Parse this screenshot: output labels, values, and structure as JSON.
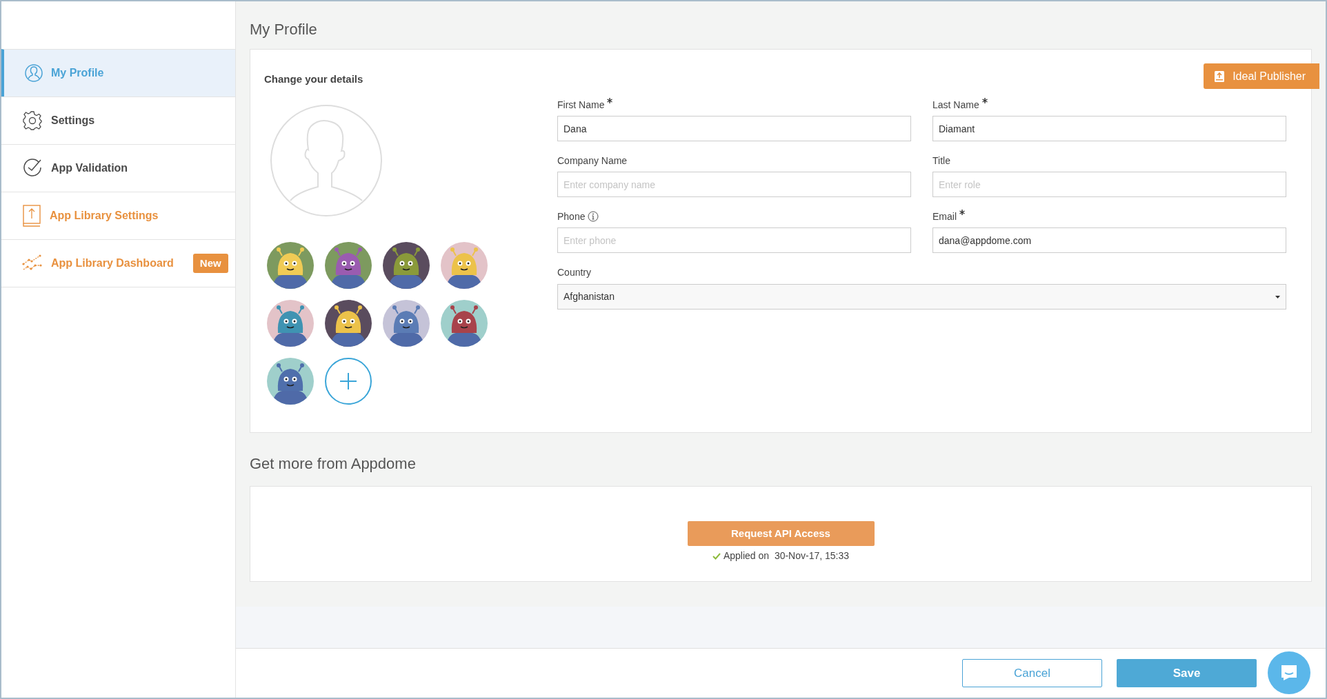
{
  "sidebar": {
    "items": [
      {
        "kind": "profile",
        "label": "My Profile",
        "selected": true,
        "color": "#4aa3d6"
      },
      {
        "kind": "settings",
        "label": "Settings",
        "selected": false,
        "color": "#4a4a4a"
      },
      {
        "kind": "validation",
        "label": "App Validation",
        "selected": false,
        "color": "#4a4a4a"
      },
      {
        "kind": "library",
        "label": "App Library Settings",
        "selected": false,
        "color": "#e8913f"
      },
      {
        "kind": "dashboard",
        "label": "App Library Dashboard",
        "selected": false,
        "color": "#e8913f",
        "badge": "New"
      }
    ]
  },
  "page_title": "My Profile",
  "details": {
    "heading": "Change your details",
    "ribbon": "Ideal Publisher",
    "avatars": [
      {
        "color": "#7d9a5f"
      },
      {
        "color": "#7d9a5f"
      },
      {
        "color": "#5a4c5e"
      },
      {
        "color": "#e3c3c8"
      },
      {
        "color": "#e3c3c8"
      },
      {
        "color": "#5a4c5e"
      },
      {
        "color": "#c5c3d8"
      },
      {
        "color": "#9fcfcb"
      },
      {
        "color": "#9fcfcb"
      }
    ],
    "fields": [
      {
        "label": "First Name",
        "required": true,
        "info": false,
        "value": "Dana"
      },
      {
        "label": "Last Name",
        "required": true,
        "info": false,
        "value": "Diamant"
      },
      {
        "label": "Company Name",
        "required": false,
        "info": false,
        "placeholder": "Enter company name"
      },
      {
        "label": "Title",
        "required": false,
        "info": false,
        "placeholder": "Enter role"
      },
      {
        "label": "Phone",
        "required": false,
        "info": true,
        "placeholder": "Enter phone"
      },
      {
        "label": "Email",
        "required": true,
        "info": false,
        "value": "dana@appdome.com"
      }
    ],
    "country": {
      "label": "Country",
      "value": "Afghanistan"
    }
  },
  "more": {
    "heading": "Get more from Appdome",
    "button": "Request API Access",
    "applied": "Applied on  30-Nov-17, 15:33"
  },
  "footer": {
    "cancel": "Cancel",
    "save": "Save"
  }
}
